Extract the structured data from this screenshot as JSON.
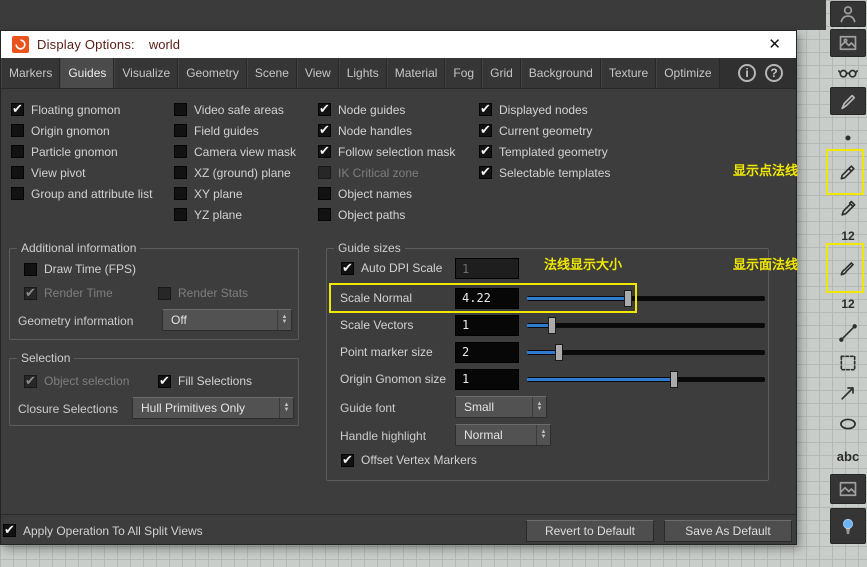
{
  "window": {
    "title": "Display Options:",
    "scope": "world",
    "close_glyph": "✕"
  },
  "tabs": {
    "items": [
      "Markers",
      "Guides",
      "Visualize",
      "Geometry",
      "Scene",
      "View",
      "Lights",
      "Material",
      "Fog",
      "Grid",
      "Background",
      "Texture",
      "Optimize"
    ],
    "active": "Guides",
    "info_glyph": "i",
    "help_glyph": "?"
  },
  "checkbox_grid": {
    "columns": [
      {
        "items": [
          {
            "label": "Floating gnomon",
            "checked": true
          },
          {
            "label": "Origin gnomon",
            "checked": false
          },
          {
            "label": "Particle gnomon",
            "checked": false
          },
          {
            "label": "View pivot",
            "checked": false
          },
          {
            "label": "Group and attribute list",
            "checked": false
          }
        ]
      },
      {
        "items": [
          {
            "label": "Video safe areas",
            "checked": false
          },
          {
            "label": "Field guides",
            "checked": false
          },
          {
            "label": "Camera view mask",
            "checked": false
          },
          {
            "label": "XZ (ground) plane",
            "checked": false
          },
          {
            "label": "XY plane",
            "checked": false
          },
          {
            "label": "YZ plane",
            "checked": false
          }
        ]
      },
      {
        "items": [
          {
            "label": "Node guides",
            "checked": true
          },
          {
            "label": "Node handles",
            "checked": true
          },
          {
            "label": "Follow selection mask",
            "checked": true
          },
          {
            "label": "IK Critical zone",
            "checked": false,
            "disabled": true
          },
          {
            "label": "Object names",
            "checked": false
          },
          {
            "label": "Object paths",
            "checked": false
          }
        ]
      },
      {
        "items": [
          {
            "label": "Displayed nodes",
            "checked": true
          },
          {
            "label": "Current geometry",
            "checked": true
          },
          {
            "label": "Templated geometry",
            "checked": true
          },
          {
            "label": "Selectable templates",
            "checked": true
          }
        ]
      }
    ]
  },
  "additional_information": {
    "title": "Additional information",
    "draw_time": {
      "label": "Draw Time (FPS)",
      "checked": false
    },
    "render_time": {
      "label": "Render Time",
      "checked": true,
      "disabled": true
    },
    "render_stats": {
      "label": "Render Stats",
      "checked": false,
      "disabled": true
    },
    "geometry_information": {
      "label": "Geometry information",
      "value": "Off"
    }
  },
  "selection": {
    "title": "Selection",
    "object_selection": {
      "label": "Object selection",
      "checked": true,
      "disabled": true
    },
    "fill_selections": {
      "label": "Fill Selections",
      "checked": true
    },
    "closure_selections": {
      "label": "Closure Selections",
      "value": "Hull Primitives Only"
    }
  },
  "guide_sizes": {
    "title": "Guide sizes",
    "auto_dpi_scale": {
      "label": "Auto DPI Scale",
      "checked": true,
      "value": "1"
    },
    "sliders": [
      {
        "label": "Scale Normal",
        "value": "4.22",
        "position": 0.42
      },
      {
        "label": "Scale Vectors",
        "value": "1",
        "position": 0.09
      },
      {
        "label": "Point marker size",
        "value": "2",
        "position": 0.12
      },
      {
        "label": "Origin Gnomon size",
        "value": "1",
        "position": 0.62
      }
    ],
    "guide_font": {
      "label": "Guide font",
      "value": "Small"
    },
    "handle_highlight": {
      "label": "Handle highlight",
      "value": "Normal"
    },
    "offset_vertex_markers": {
      "label": "Offset Vertex Markers",
      "checked": true
    }
  },
  "footer": {
    "apply": {
      "label": "Apply Operation To All Split Views",
      "checked": true
    },
    "buttons": [
      {
        "label": "Revert to Default"
      },
      {
        "label": "Save As Default"
      }
    ]
  },
  "annotations": {
    "highlight_color": "#f0e800",
    "scale_normal_note": "法线显示大小",
    "point_normals_note": "显示点法线",
    "prim_normals_note": "显示面法线"
  },
  "side_toolbar": {
    "point_numbers_label": "12",
    "prim_numbers_label": "12",
    "text_label": "abc",
    "icons": [
      "character-tool-icon",
      "snapshot-icon",
      "spectacles-icon",
      "paint-tool-icon",
      "point-display-icon",
      "point-normals-icon",
      "color-picker-icon",
      "point-numbers-icon",
      "prim-normals-icon",
      "prim-numbers-icon",
      "profile-curve-icon",
      "group-region-icon",
      "vector-arrow-icon",
      "ellipse-icon",
      "text-labels-icon",
      "background-image-icon",
      "lighting-icon"
    ]
  }
}
